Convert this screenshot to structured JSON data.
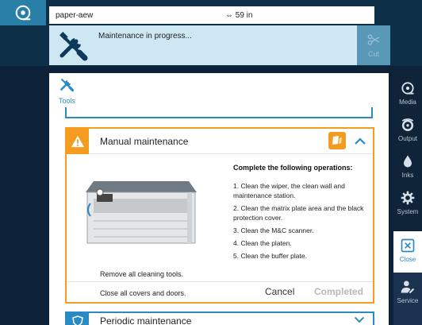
{
  "status": {
    "media_name": "paper-aew",
    "media_length": "59 in",
    "message": "Maintenance in progress...",
    "cut_label": "Cut"
  },
  "nav": {
    "media": "Media",
    "output": "Output",
    "inks": "Inks",
    "system": "System",
    "close": "Close",
    "service": "Service"
  },
  "panel": {
    "tools_label": "Tools"
  },
  "manual": {
    "title": "Manual maintenance",
    "ops_title": "Complete the following operations:",
    "ops": [
      "1. Clean the wiper, the clean wall and maintenance station.",
      "2. Clean the matrix plate area and the black protection cover.",
      "3. Clean the M&C scanner.",
      "4. Clean the platen.",
      "5. Clean the buffer plate."
    ],
    "remove_tools": "Remove all cleaning tools.",
    "close_covers": "Close all covers and doors.",
    "cancel_label": "Cancel",
    "completed_label": "Completed"
  },
  "periodic": {
    "title": "Periodic maintenance"
  },
  "colors": {
    "accent_blue": "#2a8ac4",
    "warning_orange": "#f39c1f",
    "banner_bg": "#cde8f3",
    "dark_bg": "#0d2238"
  }
}
